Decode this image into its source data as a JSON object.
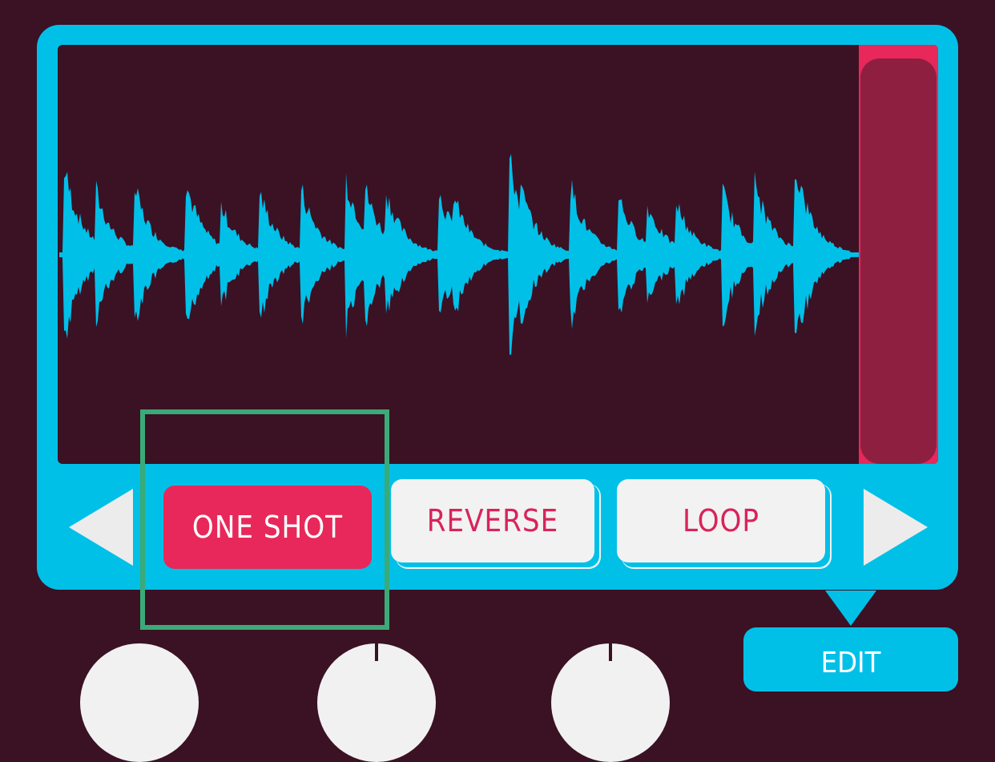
{
  "waveform": {
    "color": "#00c0e8",
    "background": "#3b1124",
    "end_marker_color": "#e8285a"
  },
  "modes": {
    "one_shot": "ONE SHOT",
    "reverse": "REVERSE",
    "loop": "LOOP",
    "selected": "ONE SHOT"
  },
  "edit_tab": {
    "label": "EDIT"
  },
  "knobs": [
    {
      "id": "knob-1",
      "value": 0.0
    },
    {
      "id": "knob-2",
      "value": 0.5
    },
    {
      "id": "knob-3",
      "value": 0.5
    }
  ],
  "colors": {
    "accent": "#00c0e8",
    "active": "#e8285a",
    "highlight": "#3aaa78"
  }
}
